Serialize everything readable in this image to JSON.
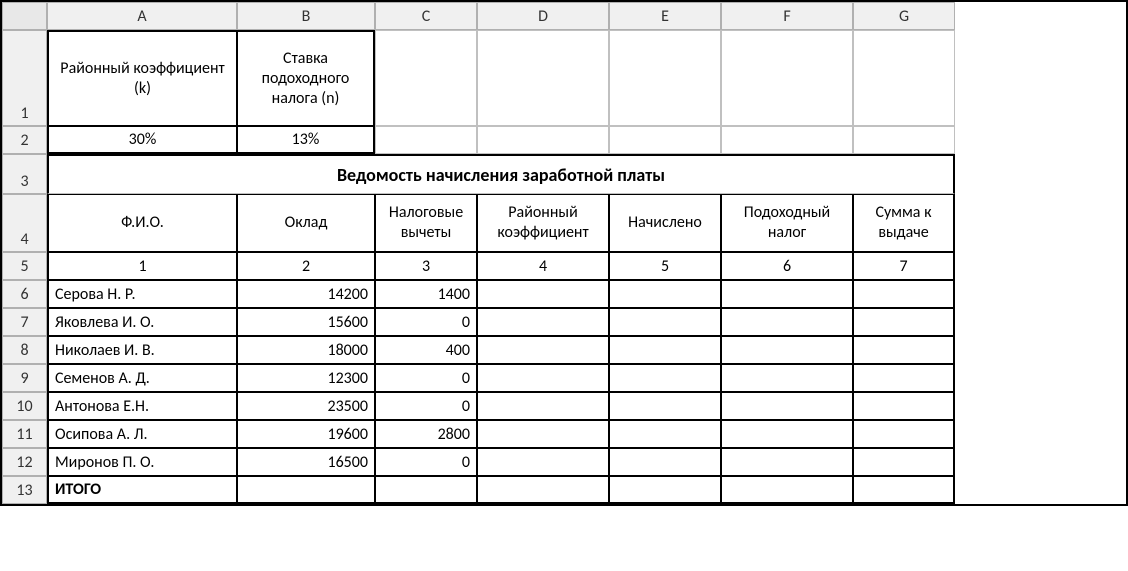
{
  "columns": [
    "A",
    "B",
    "C",
    "D",
    "E",
    "F",
    "G"
  ],
  "row_numbers": [
    1,
    2,
    3,
    4,
    5,
    6,
    7,
    8,
    9,
    10,
    11,
    12,
    13
  ],
  "params_header": {
    "A": "Районный коэффициент (k)",
    "B": "Ставка подоходного налога (n)"
  },
  "params_values": {
    "A": "30%",
    "B": "13%"
  },
  "title": "Ведомость начисления заработной платы",
  "table_headers": {
    "A": "Ф.И.О.",
    "B": "Оклад",
    "C": "Налоговые вычеты",
    "D": "Районный коэффициент",
    "E": "Начислено",
    "F": "Подоходный налог",
    "G": "Сумма к выдаче"
  },
  "col_numbers": {
    "A": "1",
    "B": "2",
    "C": "3",
    "D": "4",
    "E": "5",
    "F": "6",
    "G": "7"
  },
  "rows": [
    {
      "fio": "Серова Н. Р.",
      "oklad": "14200",
      "vychety": "1400",
      "rk": "",
      "nach": "",
      "nalog": "",
      "summa": ""
    },
    {
      "fio": "Яковлева И. О.",
      "oklad": "15600",
      "vychety": "0",
      "rk": "",
      "nach": "",
      "nalog": "",
      "summa": ""
    },
    {
      "fio": "Николаев И. В.",
      "oklad": "18000",
      "vychety": "400",
      "rk": "",
      "nach": "",
      "nalog": "",
      "summa": ""
    },
    {
      "fio": "Семенов А. Д.",
      "oklad": "12300",
      "vychety": "0",
      "rk": "",
      "nach": "",
      "nalog": "",
      "summa": ""
    },
    {
      "fio": "Антонова Е.Н.",
      "oklad": "23500",
      "vychety": "0",
      "rk": "",
      "nach": "",
      "nalog": "",
      "summa": ""
    },
    {
      "fio": "Осипова А. Л.",
      "oklad": "19600",
      "vychety": "2800",
      "rk": "",
      "nach": "",
      "nalog": "",
      "summa": ""
    },
    {
      "fio": "Миронов П. О.",
      "oklad": "16500",
      "vychety": "0",
      "rk": "",
      "nach": "",
      "nalog": "",
      "summa": ""
    }
  ],
  "total_label": "ИТОГО"
}
